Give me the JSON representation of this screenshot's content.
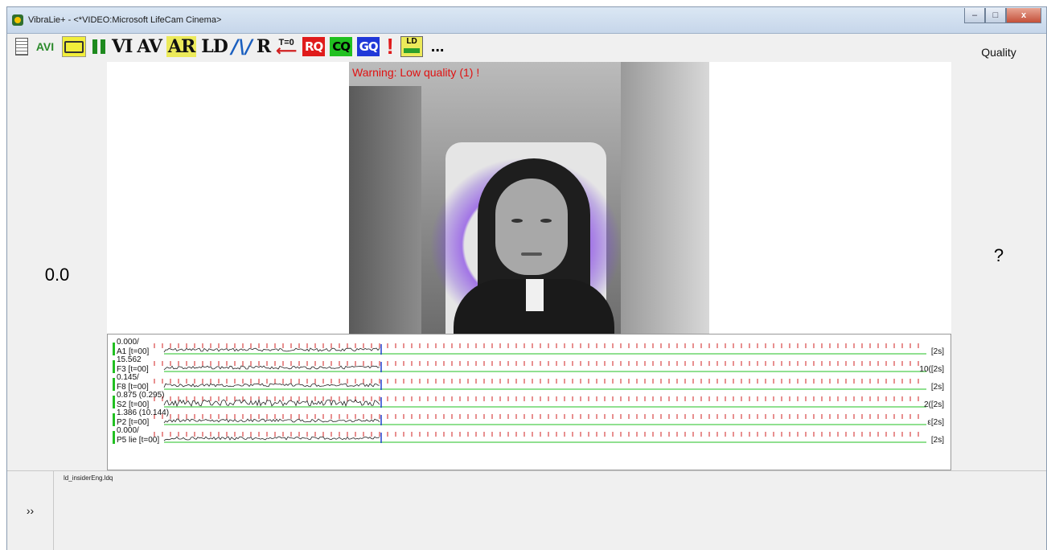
{
  "window": {
    "title": "VibraLie+ - <*VIDEO:Microsoft LifeCam Cinema>",
    "controls": {
      "minimize": "–",
      "maximize": "□",
      "close": "x"
    }
  },
  "toolbar": {
    "avi": "AVI",
    "vi": "VI",
    "av": "AV",
    "ar": "AR",
    "ld": "LD",
    "r": "R",
    "t0": "T=0",
    "rq": "RQ",
    "cq": "CQ",
    "gq": "GQ",
    "alert": "!",
    "ld_small": "LD",
    "more": "..."
  },
  "score": {
    "value": "0.0"
  },
  "quality": {
    "label": "Quality",
    "value": "?"
  },
  "video": {
    "warning": "Warning: Low quality (1) !"
  },
  "traces": [
    {
      "top_value": "0.000/",
      "label": "A1 [t=00]",
      "right": "[2s]"
    },
    {
      "top_value": "15.562",
      "label": "F3 [t=00]",
      "right": "10([2s]"
    },
    {
      "top_value": "0.145/",
      "label": "F8 [t=00]",
      "right": "[2s]"
    },
    {
      "top_value": "0.875 (0.295)",
      "label": "S2 [t=00]",
      "right": "2([2s]"
    },
    {
      "top_value": "1.386 (10.144)",
      "label": "P2 [t=00]",
      "right": "ε[2s]"
    },
    {
      "top_value": "0.000/",
      "label": "P5 lie [t=00]",
      "right": "[2s]"
    }
  ],
  "bottom": {
    "expand_label": "››",
    "file_label": "ld_insiderEng.ldq"
  },
  "colors": {
    "warning": "#e01010",
    "trace_baseline": "#22c022",
    "tick": "#d02020",
    "cursor": "#2040d0"
  }
}
